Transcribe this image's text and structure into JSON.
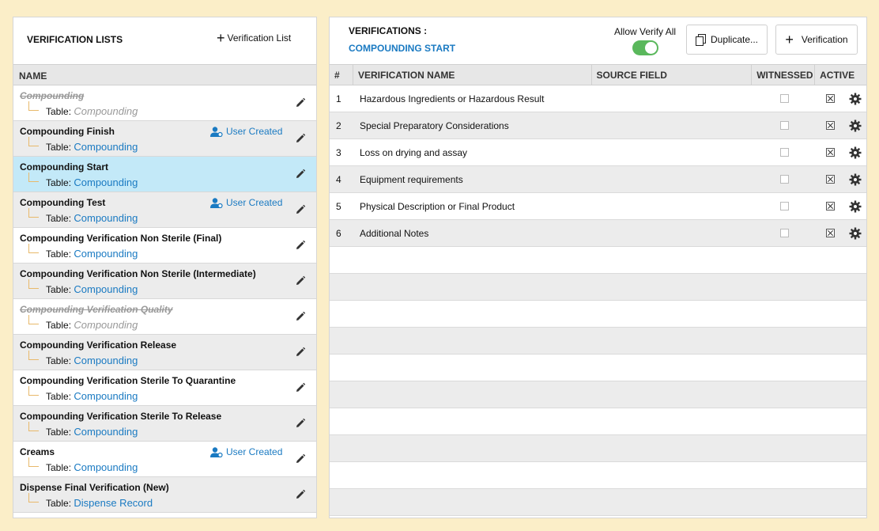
{
  "left": {
    "title": "VERIFICATION LISTS",
    "add_label": "Verification List",
    "col_name": "NAME",
    "table_prefix": "Table:",
    "user_created_label": "User Created",
    "items": [
      {
        "name": "Compounding",
        "table": "Compounding",
        "inactive": true,
        "user_created": false
      },
      {
        "name": "Compounding Finish",
        "table": "Compounding",
        "inactive": false,
        "user_created": true
      },
      {
        "name": "Compounding Start",
        "table": "Compounding",
        "inactive": false,
        "user_created": false,
        "selected": true
      },
      {
        "name": "Compounding Test",
        "table": "Compounding",
        "inactive": false,
        "user_created": true
      },
      {
        "name": "Compounding Verification Non Sterile (Final)",
        "table": "Compounding",
        "inactive": false,
        "user_created": false
      },
      {
        "name": "Compounding Verification Non Sterile (Intermediate)",
        "table": "Compounding",
        "inactive": false,
        "user_created": false
      },
      {
        "name": "Compounding Verification Quality",
        "table": "Compounding",
        "inactive": true,
        "user_created": false
      },
      {
        "name": "Compounding Verification Release",
        "table": "Compounding",
        "inactive": false,
        "user_created": false
      },
      {
        "name": "Compounding Verification Sterile To Quarantine",
        "table": "Compounding",
        "inactive": false,
        "user_created": false
      },
      {
        "name": "Compounding Verification Sterile To Release",
        "table": "Compounding",
        "inactive": false,
        "user_created": false
      },
      {
        "name": "Creams",
        "table": "Compounding",
        "inactive": false,
        "user_created": true
      },
      {
        "name": "Dispense Final Verification (New)",
        "table": "Dispense Record",
        "inactive": false,
        "user_created": false
      }
    ]
  },
  "right": {
    "title": "VERIFICATIONS :",
    "subtitle": "COMPOUNDING START",
    "allow_verify_label": "Allow Verify All",
    "allow_verify_on": true,
    "duplicate_label": "Duplicate...",
    "add_verification_label": "Verification",
    "columns": {
      "num": "#",
      "name": "VERIFICATION NAME",
      "source": "SOURCE FIELD",
      "witnessed": "WITNESSED",
      "active": "ACTIVE"
    },
    "rows": [
      {
        "num": "1",
        "name": "Hazardous Ingredients or Hazardous Result",
        "source": "",
        "witnessed": false,
        "active": true
      },
      {
        "num": "2",
        "name": "Special Preparatory Considerations",
        "source": "",
        "witnessed": false,
        "active": true
      },
      {
        "num": "3",
        "name": "Loss on drying and assay",
        "source": "",
        "witnessed": false,
        "active": true
      },
      {
        "num": "4",
        "name": "Equipment requirements",
        "source": "",
        "witnessed": false,
        "active": true
      },
      {
        "num": "5",
        "name": "Physical Description or Final Product",
        "source": "",
        "witnessed": false,
        "active": true
      },
      {
        "num": "6",
        "name": "Additional Notes",
        "source": "",
        "witnessed": false,
        "active": true
      }
    ]
  },
  "colors": {
    "background": "#fbeec8",
    "accent": "#1a7ac2",
    "selected_row": "#c3e9f8",
    "toggle_on": "#5ab85c"
  }
}
